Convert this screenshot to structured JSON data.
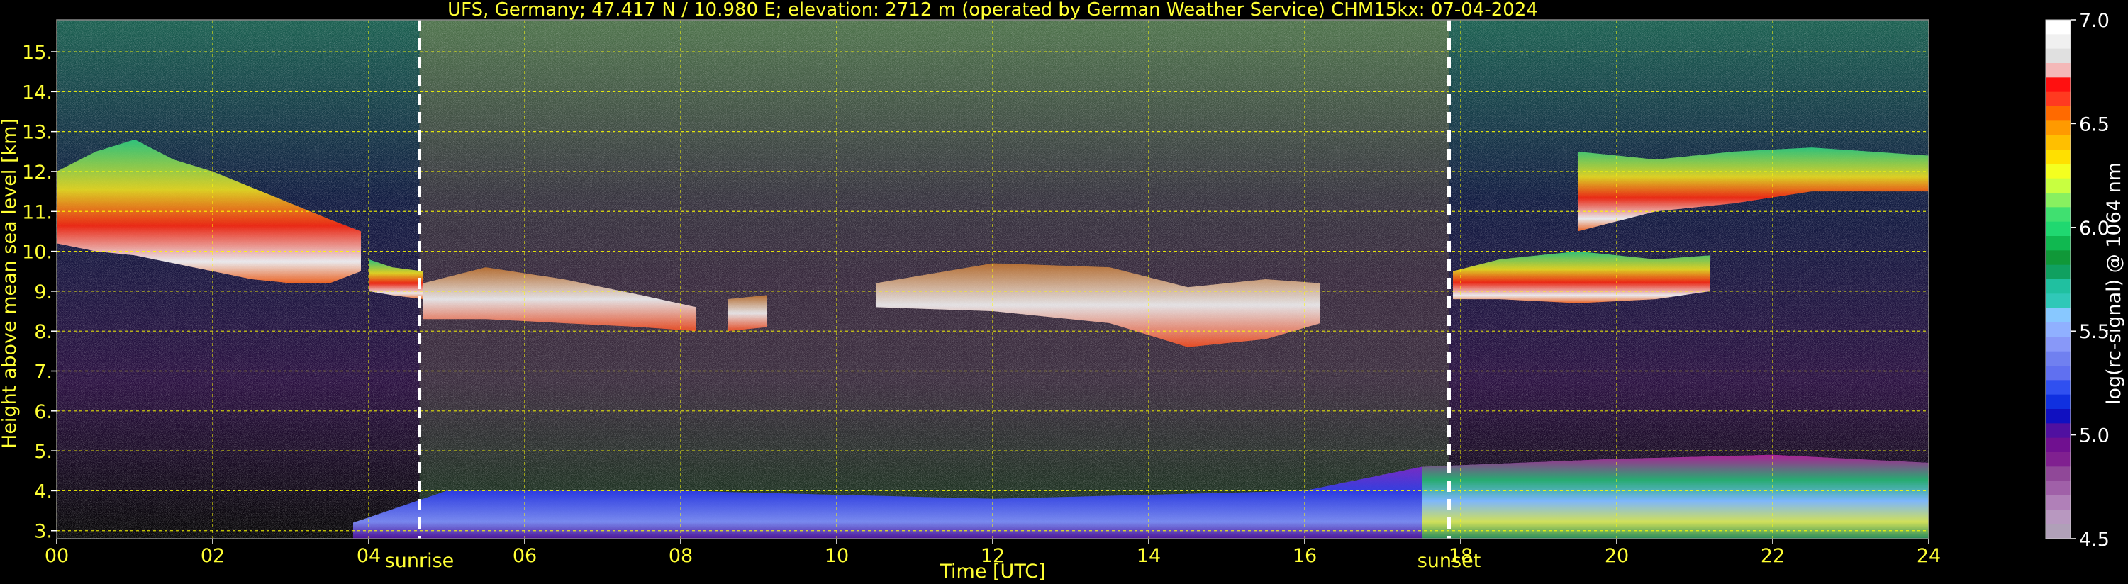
{
  "chart_data": {
    "type": "heatmap",
    "title": "UFS, Germany; 47.417 N / 10.980 E; elevation: 2712 m  (operated by German Weather Service)    CHM15kx: 07-04-2024",
    "xlabel": "Time [UTC]",
    "ylabel": "Height above mean sea level [km]",
    "xlim": [
      0,
      24
    ],
    "ylim": [
      2.8,
      15.8
    ],
    "x_ticks": [
      {
        "value": 0,
        "label": "00"
      },
      {
        "value": 2,
        "label": "02"
      },
      {
        "value": 4,
        "label": "04"
      },
      {
        "value": 6,
        "label": "06"
      },
      {
        "value": 8,
        "label": "08"
      },
      {
        "value": 10,
        "label": "10"
      },
      {
        "value": 12,
        "label": "12"
      },
      {
        "value": 14,
        "label": "14"
      },
      {
        "value": 16,
        "label": "16"
      },
      {
        "value": 18,
        "label": "18"
      },
      {
        "value": 20,
        "label": "20"
      },
      {
        "value": 22,
        "label": "22"
      },
      {
        "value": 24,
        "label": "24"
      }
    ],
    "y_ticks": [
      {
        "value": 3,
        "label": "3."
      },
      {
        "value": 4,
        "label": "4."
      },
      {
        "value": 5,
        "label": "5."
      },
      {
        "value": 6,
        "label": "6."
      },
      {
        "value": 7,
        "label": "7."
      },
      {
        "value": 8,
        "label": "8."
      },
      {
        "value": 9,
        "label": "9."
      },
      {
        "value": 10,
        "label": "10."
      },
      {
        "value": 11,
        "label": "11."
      },
      {
        "value": 12,
        "label": "12."
      },
      {
        "value": 13,
        "label": "13."
      },
      {
        "value": 14,
        "label": "14."
      },
      {
        "value": 15,
        "label": "15."
      }
    ],
    "grid": true,
    "grid_color": "#ffff00",
    "annotations": [
      {
        "x": 4.65,
        "label": "sunrise"
      },
      {
        "x": 17.85,
        "label": "sunset"
      }
    ],
    "colorbar": {
      "label": "log(rc-signal) @ 1064 nm",
      "range": [
        4.5,
        7.0
      ],
      "ticks": [
        {
          "value": 7.0,
          "label": "7.0"
        },
        {
          "value": 6.5,
          "label": "6.5"
        },
        {
          "value": 6.0,
          "label": "6.0"
        },
        {
          "value": 5.5,
          "label": "5.5"
        },
        {
          "value": 5.0,
          "label": "5.0"
        },
        {
          "value": 4.5,
          "label": "4.5"
        }
      ],
      "colors_top_to_bottom": [
        "#ffffff",
        "#f0f0f0",
        "#e0e0e0",
        "#f4b8b8",
        "#ff1010",
        "#ff3a20",
        "#ff6a00",
        "#ff9a00",
        "#ffbf00",
        "#ffe000",
        "#f4ff20",
        "#c8ff40",
        "#88f060",
        "#40e070",
        "#20d870",
        "#10b850",
        "#109838",
        "#10a060",
        "#20c0a0",
        "#30c8b8",
        "#88c8ff",
        "#90b0ff",
        "#8898f8",
        "#7080f0",
        "#6070f0",
        "#3050f0",
        "#1030e0",
        "#1010c0",
        "#5010a0",
        "#701090",
        "#802090",
        "#904898",
        "#a060a8",
        "#b080b8",
        "#b898c0",
        "#b0a0b8"
      ]
    },
    "cloud_layers": [
      {
        "name": "cirrus_night",
        "x": [
          0,
          0.5,
          1,
          1.5,
          2,
          2.5,
          3,
          3.5,
          3.9
        ],
        "base": [
          10.2,
          10.0,
          9.9,
          9.7,
          9.5,
          9.3,
          9.2,
          9.2,
          9.5
        ],
        "top": [
          12.0,
          12.5,
          12.8,
          12.3,
          12.0,
          11.6,
          11.2,
          10.8,
          10.5
        ]
      },
      {
        "name": "dawn_layer",
        "x": [
          4.0,
          4.3,
          4.7
        ],
        "base": [
          9.0,
          8.9,
          8.8
        ],
        "top": [
          9.8,
          9.6,
          9.5
        ]
      },
      {
        "name": "day_layer_1",
        "x": [
          4.7,
          5.5,
          6.5,
          7.5,
          8.2
        ],
        "base": [
          8.3,
          8.3,
          8.2,
          8.1,
          8.0
        ],
        "top": [
          9.2,
          9.6,
          9.3,
          8.9,
          8.6
        ]
      },
      {
        "name": "day_layer_2",
        "x": [
          8.6,
          9.1
        ],
        "base": [
          8.0,
          8.1
        ],
        "top": [
          8.8,
          8.9
        ]
      },
      {
        "name": "day_layer_3",
        "x": [
          10.5,
          12,
          13.5,
          14.5,
          15.5,
          16.2
        ],
        "base": [
          8.6,
          8.5,
          8.2,
          7.6,
          7.8,
          8.2
        ],
        "top": [
          9.2,
          9.7,
          9.6,
          9.1,
          9.3,
          9.2
        ]
      },
      {
        "name": "evening_cirrus",
        "x": [
          17.9,
          18.5,
          19.5,
          20.5,
          21.2
        ],
        "base": [
          8.8,
          8.8,
          8.7,
          8.8,
          9.0
        ],
        "top": [
          9.5,
          9.8,
          10.0,
          9.8,
          9.9
        ]
      },
      {
        "name": "evening_high",
        "x": [
          19.5,
          20.5,
          21.5,
          22.5,
          24
        ],
        "base": [
          10.5,
          11.0,
          11.2,
          11.5,
          11.5
        ],
        "top": [
          12.5,
          12.3,
          12.5,
          12.6,
          12.4
        ]
      }
    ],
    "boundary_layer": {
      "x": [
        3.8,
        5,
        8,
        12,
        16,
        17.5,
        20,
        22,
        24
      ],
      "top": [
        3.2,
        4.0,
        4.0,
        3.8,
        4.0,
        4.6,
        4.8,
        4.9,
        4.7
      ]
    }
  }
}
